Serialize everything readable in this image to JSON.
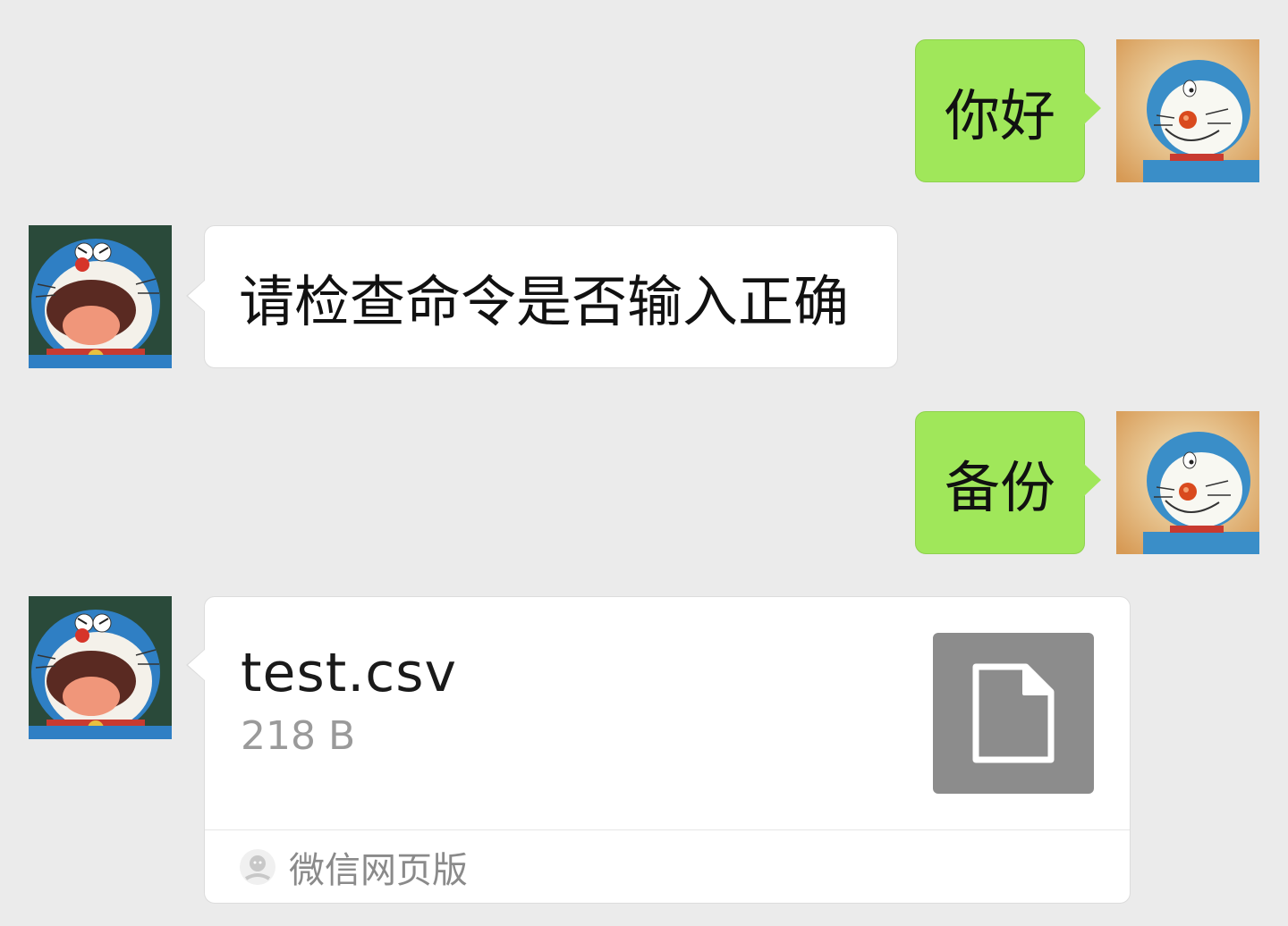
{
  "messages": [
    {
      "direction": "outgoing",
      "text": "你好",
      "bubble_color": "#a0e75a"
    },
    {
      "direction": "incoming",
      "text": "请检查命令是否输入正确",
      "bubble_color": "#ffffff"
    },
    {
      "direction": "outgoing",
      "text": "备份",
      "bubble_color": "#a0e75a"
    },
    {
      "direction": "incoming",
      "type": "file",
      "file_name": "test.csv",
      "file_size": "218 B",
      "source": "微信网页版",
      "file_icon": "document-icon"
    }
  ],
  "avatars": {
    "self": "doraemon-avatar-icon",
    "contact": "doraemon-tongue-avatar-icon"
  },
  "colors": {
    "background": "#ebebeb",
    "outgoing_bubble": "#a0e75a",
    "incoming_bubble": "#ffffff",
    "file_icon_bg": "#8c8c8c"
  }
}
